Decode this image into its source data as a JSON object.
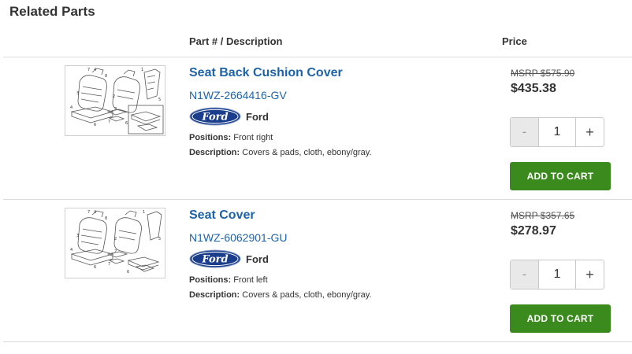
{
  "page": {
    "title": "Related Parts"
  },
  "table": {
    "col_description": "Part # / Description",
    "col_price": "Price"
  },
  "brand_color": "#1e63a8",
  "cart_color": "#3a8a1e",
  "products": [
    {
      "name": "Seat Back Cushion Cover",
      "part_number": "N1WZ-2664416-GV",
      "brand": "Ford",
      "brand_logo_text": "Ford",
      "positions_label": "Positions:",
      "positions": "Front right",
      "description_label": "Description:",
      "description": "Covers & pads, cloth, ebony/gray.",
      "msrp": "MSRP $575.90",
      "price": "$435.38",
      "quantity": "1",
      "minus_label": "-",
      "plus_label": "+",
      "cart_label": "ADD TO CART"
    },
    {
      "name": "Seat Cover",
      "part_number": "N1WZ-6062901-GU",
      "brand": "Ford",
      "brand_logo_text": "Ford",
      "positions_label": "Positions:",
      "positions": "Front left",
      "description_label": "Description:",
      "description": "Covers & pads, cloth, ebony/gray.",
      "msrp": "MSRP $357.65",
      "price": "$278.97",
      "quantity": "1",
      "minus_label": "-",
      "plus_label": "+",
      "cart_label": "ADD TO CART"
    }
  ]
}
